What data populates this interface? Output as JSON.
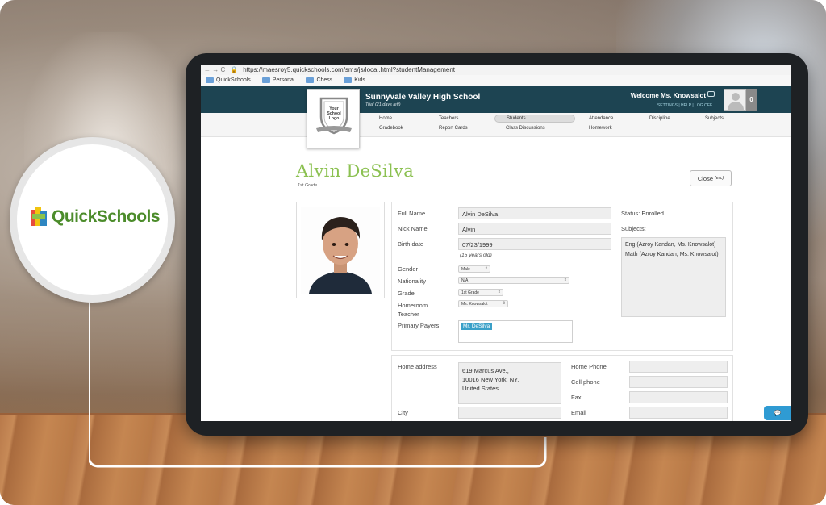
{
  "browser": {
    "url": "https://maesroy5.quickschools.com/sms/js/local.html?studentManagement",
    "bookmarks": [
      "QuickSchools",
      "Personal",
      "Chess",
      "Kids"
    ]
  },
  "header": {
    "school_name": "Sunnyvale Valley High School",
    "trial": "Trial (21 days left)",
    "welcome": "Welcome Ms. Knowsalot",
    "links": "SETTINGS  |  HELP  |  LOG OFF",
    "count": "0"
  },
  "logo": {
    "text": "Your School Logo"
  },
  "menu": {
    "row1": [
      "Home",
      "Teachers",
      "Students",
      "Attendance",
      "Discipline",
      "Subjects"
    ],
    "row2": [
      "Gradebook",
      "Report Cards",
      "Class Discussions",
      "Homework"
    ],
    "active": "Students"
  },
  "student": {
    "name": "Alvin DeSilva",
    "grade": "1st Grade",
    "close_label": "Close",
    "close_hint": "(esc)"
  },
  "form": {
    "full_name_label": "Full Name",
    "full_name": "Alvin DeSilva",
    "nick_name_label": "Nick Name",
    "nick_name": "Alvin",
    "birth_date_label": "Birth date",
    "birth_date": "07/23/1999",
    "age_hint": "(15 years old)",
    "gender_label": "Gender",
    "gender": "Male",
    "nationality_label": "Nationality",
    "nationality": "N/A",
    "grade_label": "Grade",
    "grade": "1st Grade",
    "homeroom_label": "Homeroom Teacher",
    "homeroom": "Ms. Knowsalot",
    "payers_label": "Primary Payers",
    "payer": "Mr. DeSilva",
    "status": "Status: Enrolled",
    "subjects_label": "Subjects:",
    "subjects": [
      "Eng  (Azroy Kandan, Ms. Knowsalot)",
      "Math  (Azroy Kandan, Ms. Knowsalot)"
    ]
  },
  "address": {
    "home_address_label": "Home address",
    "lines": [
      "619 Marcus Ave.,",
      "10016 New York, NY,",
      "United States"
    ],
    "city_label": "City",
    "home_phone_label": "Home Phone",
    "cell_label": "Cell phone",
    "fax_label": "Fax",
    "email_label": "Email"
  },
  "callout": {
    "brand": "QuickSchools"
  },
  "colors": {
    "header": "#1d4452",
    "accent_green": "#8cc152",
    "brand_green": "#4c8c2b",
    "tag_blue": "#3aa0c8"
  }
}
